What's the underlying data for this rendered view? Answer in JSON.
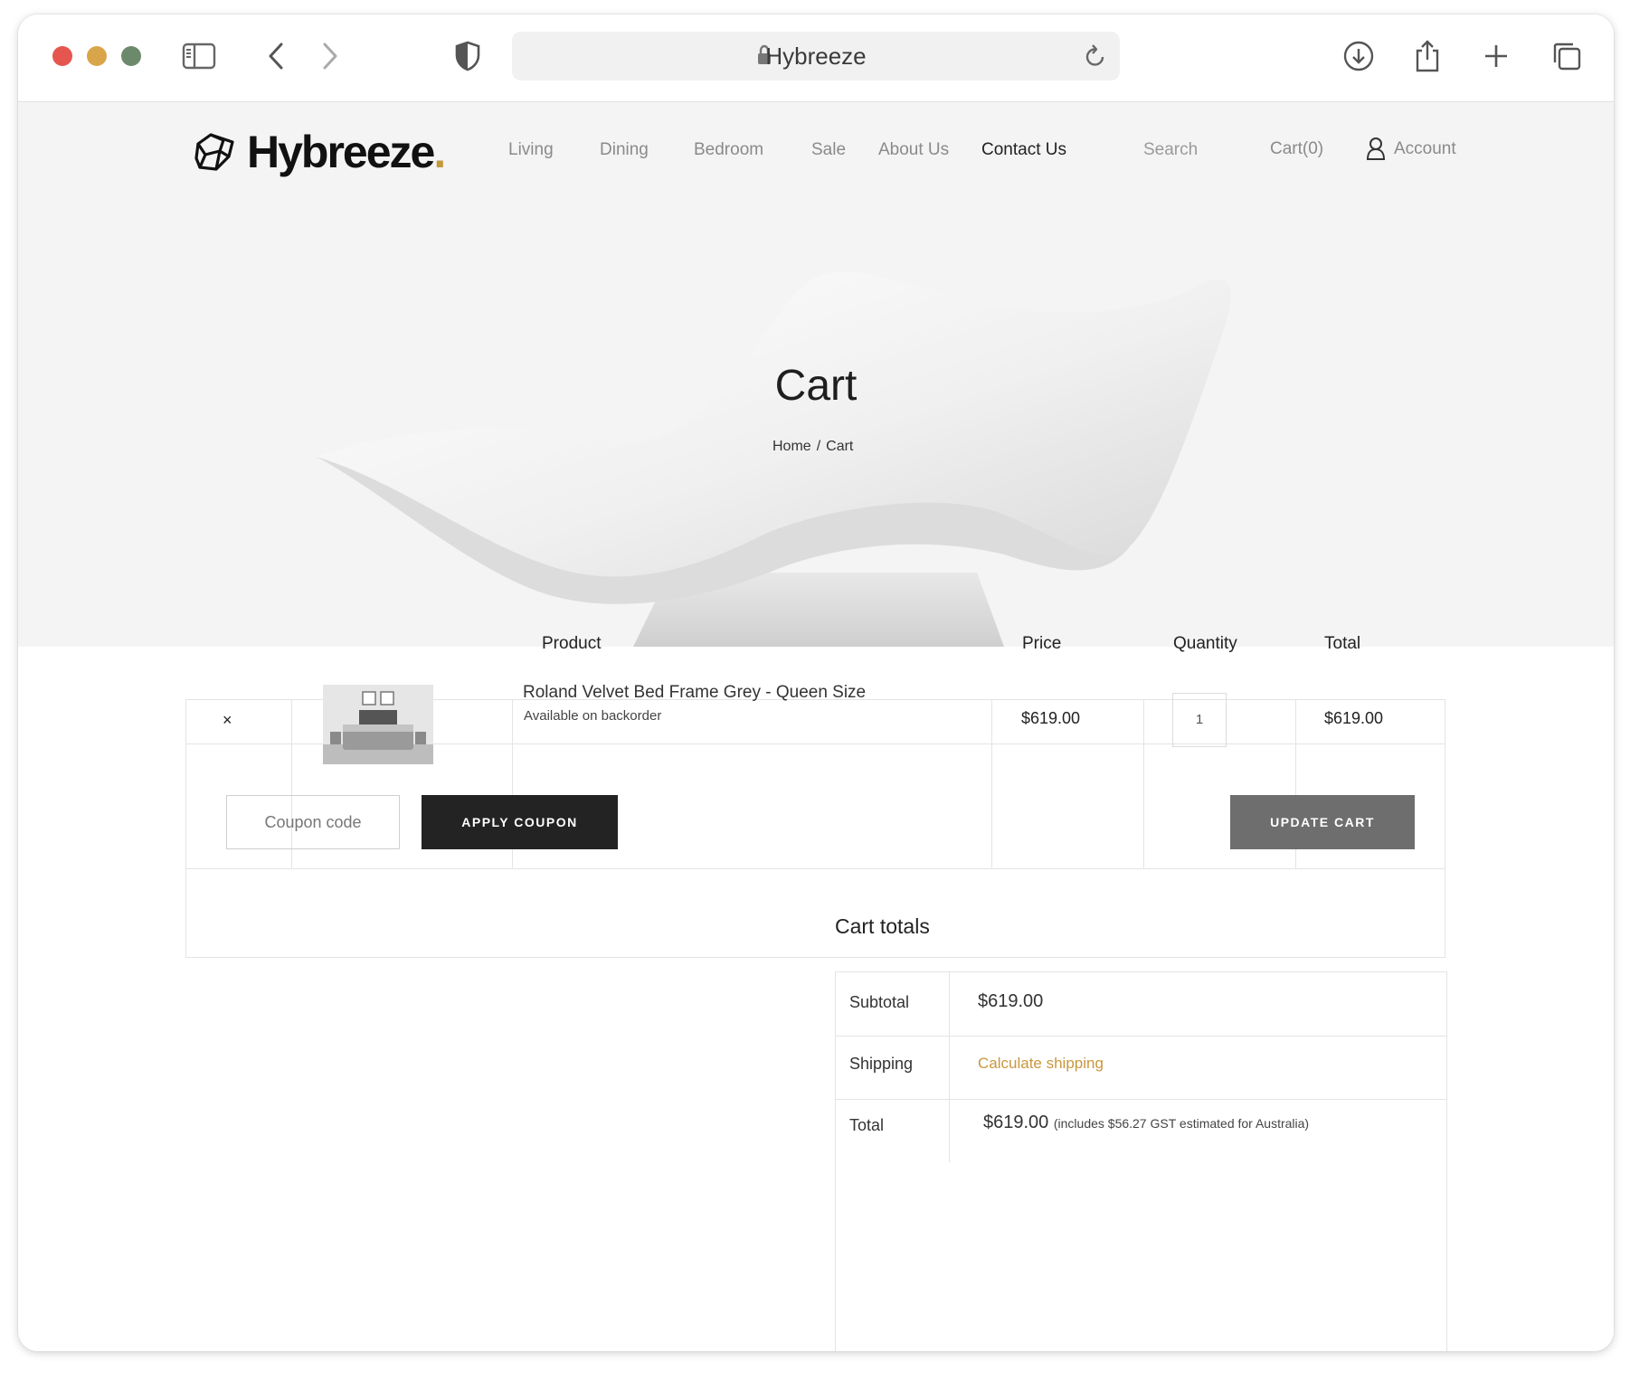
{
  "browser": {
    "address_title": "Hybreeze"
  },
  "site": {
    "logo_text": "Hybreeze",
    "logo_dot": ".",
    "nav": {
      "living": "Living",
      "dining": "Dining",
      "bedroom": "Bedroom",
      "sale": "Sale",
      "about": "About Us",
      "contact": "Contact Us",
      "search": "Search",
      "cart": "Cart(0)",
      "account": "Account"
    }
  },
  "hero": {
    "title": "Cart",
    "breadcrumb": {
      "home": "Home",
      "separator": "/",
      "current": "Cart"
    }
  },
  "cart_table": {
    "headers": {
      "product": "Product",
      "price": "Price",
      "quantity": "Quantity",
      "total": "Total"
    },
    "item": {
      "remove": "×",
      "name": "Roland Velvet Bed Frame Grey - Queen Size",
      "status": "Available on backorder",
      "price": "$619.00",
      "quantity": "1",
      "total": "$619.00"
    },
    "coupon_placeholder": "Coupon code",
    "apply_coupon": "APPLY COUPON",
    "update_cart": "UPDATE CART"
  },
  "totals": {
    "title": "Cart totals",
    "subtotal_label": "Subtotal",
    "subtotal_value": "$619.00",
    "shipping_label": "Shipping",
    "shipping_link": "Calculate shipping",
    "total_label": "Total",
    "total_value": "$619.00",
    "total_note": "(includes $56.27 GST estimated for Australia)"
  },
  "colors": {
    "accent_gold": "#c8973c",
    "dark_button": "#232323",
    "grey_button": "#6e6e6e",
    "hero_bg": "#f4f4f4"
  }
}
